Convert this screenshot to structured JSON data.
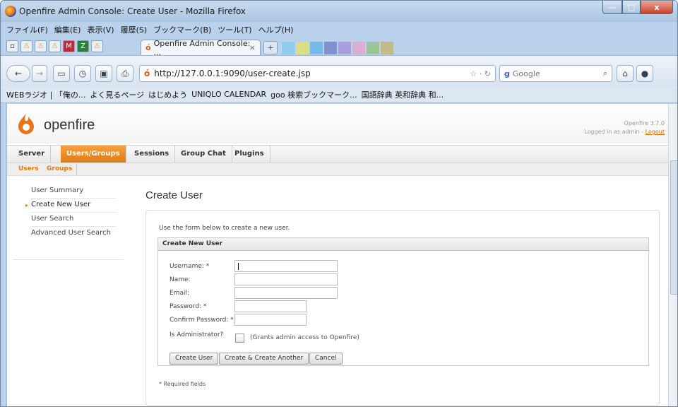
{
  "window": {
    "title": "Openfire Admin Console: Create User - Mozilla Firefox",
    "controls": {
      "minimize": "—",
      "maximize": "□",
      "close": "x"
    }
  },
  "menubar": {
    "items": [
      "ファイル(F)",
      "編集(E)",
      "表示(V)",
      "履歴(S)",
      "ブックマーク(B)",
      "ツール(T)",
      "ヘルプ(H)"
    ]
  },
  "tabs": {
    "active_label": "Openfire Admin Console: ...",
    "close": "×",
    "new_tab": "+"
  },
  "navbar": {
    "url": "http://127.0.0.1:9090/user-create.jsp",
    "search_placeholder": "Google",
    "back": "←",
    "forward": "→"
  },
  "bookmarks": {
    "items": [
      "WEBラジオ | 「俺の...",
      "よく見るページ",
      "はじめよう",
      "UNIQLO CALENDAR",
      "goo 検索ブックマーク...",
      "国語辞典 英和辞典 和..."
    ]
  },
  "openfire": {
    "brand": "openfire",
    "version": "Openfire 3.7.0",
    "logged_in": "Logged in as admin -",
    "logout": "Logout",
    "main_nav": [
      "Server",
      "Users/Groups",
      "Sessions",
      "Group Chat",
      "Plugins"
    ],
    "sub_nav": [
      "Users",
      "Groups"
    ],
    "sidebar": [
      "User Summary",
      "Create New User",
      "User Search",
      "Advanced User Search"
    ],
    "page_title": "Create User",
    "intro": "Use the form below to create a new user.",
    "form_title": "Create New User",
    "fields": {
      "username": "Username: *",
      "name": "Name:",
      "email": "Email:",
      "password": "Password: *",
      "confirm": "Confirm Password: *",
      "admin": "Is Administrator?",
      "admin_note": "(Grants admin access to Openfire)"
    },
    "buttons": {
      "create": "Create User",
      "create_another": "Create & Create Another",
      "cancel": "Cancel"
    },
    "required_note": "* Required fields"
  },
  "colors": {
    "accent": "#df7b14",
    "window_frame": "#b9d1ea"
  }
}
